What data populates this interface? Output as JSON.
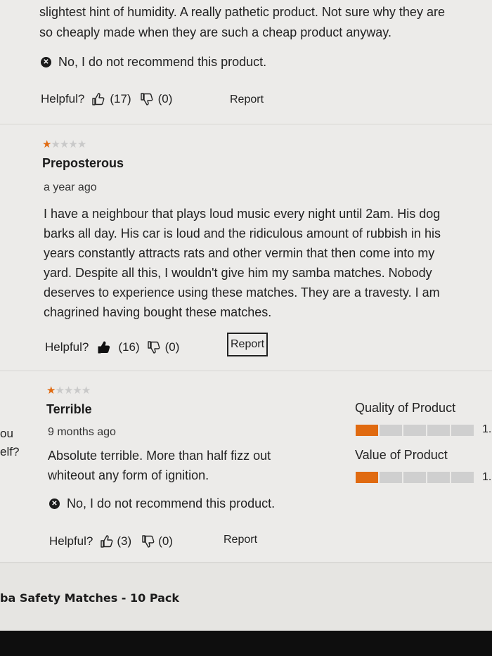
{
  "review_top": {
    "body_lines": [
      "slightest hint of humidity. A really pathetic product. Not sure why they are",
      "so cheaply made when they are such a cheap product anyway."
    ],
    "recommendation": "No, I do not recommend this product.",
    "helpful_label": "Helpful?",
    "up_count": "(17)",
    "down_count": "(0)",
    "report_label": "Report"
  },
  "review_mid": {
    "rating": 1,
    "title": "Preposterous",
    "date": "a year ago",
    "body_lines": [
      "I have a neighbour that plays loud music every night until 2am. His dog",
      "barks all day. His car is loud and the ridiculous amount of rubbish in his",
      "years constantly attracts rats and other vermin that then come into my",
      "yard. Despite all this, I wouldn't give him my samba matches. Nobody",
      "deserves to experience using these matches. They are a travesty. I am",
      "chagrined having bought these matches."
    ],
    "helpful_label": "Helpful?",
    "up_count": "(16)",
    "down_count": "(0)",
    "report_label": "Report"
  },
  "review_bottom": {
    "rating": 1,
    "title": "Terrible",
    "date": "9 months ago",
    "body_lines": [
      "Absolute terrible. More than half fizz out",
      "whiteout any form of ignition."
    ],
    "recommendation": "No, I do not recommend this product.",
    "helpful_label": "Helpful?",
    "up_count": "(3)",
    "down_count": "(0)",
    "report_label": "Report",
    "ratings": [
      {
        "label": "Quality of Product",
        "value_text": "1.",
        "fraction": 0.2
      },
      {
        "label": "Value of Product",
        "value_text": "1.",
        "fraction": 0.2
      }
    ]
  },
  "left_cutoff": {
    "line1": "ou",
    "line2": "elf?"
  },
  "product_banner": {
    "text": "ba Safety Matches - 10 Pack"
  },
  "colors": {
    "star_accent": "#e06a10",
    "bar_fill": "#e06a10",
    "bar_empty": "#cfcfcf"
  }
}
